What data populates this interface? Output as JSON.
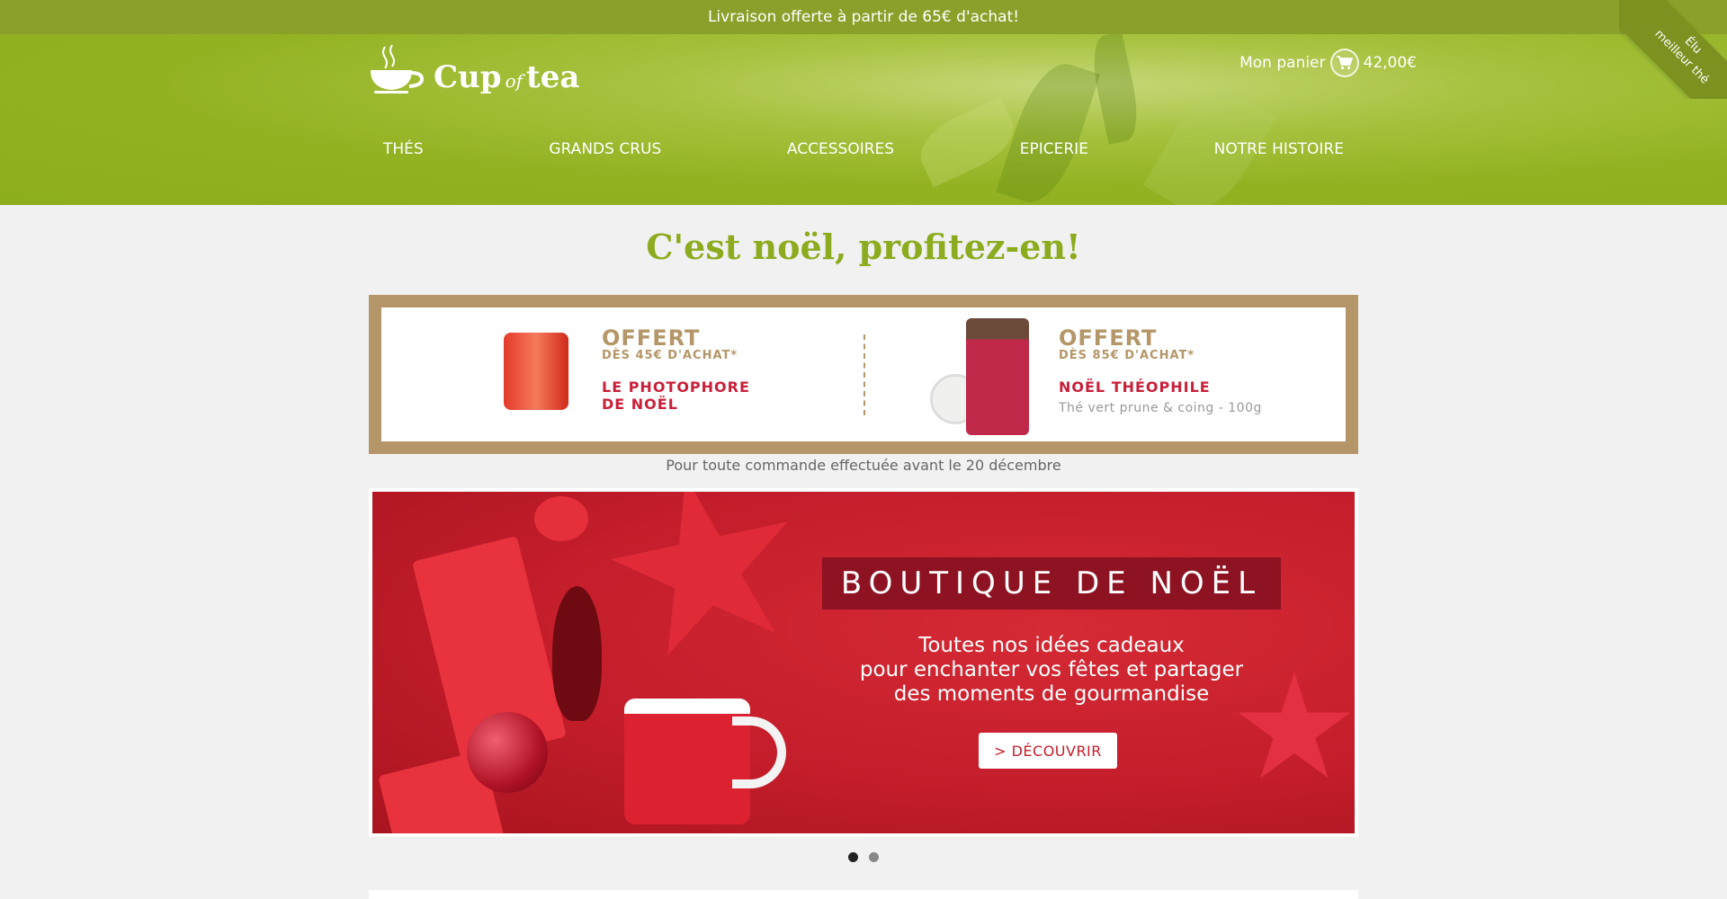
{
  "topbar": {
    "text": "Livraison offerte à partir de 65€ d'achat!"
  },
  "ribbon": {
    "line1": "Élu",
    "line2": "meilleur thé"
  },
  "logo": {
    "word1": "Cup",
    "word2": "of",
    "word3": "tea"
  },
  "cart": {
    "label": "Mon panier",
    "amount": "42,00€",
    "icon": "cart-icon"
  },
  "nav": {
    "items": [
      {
        "label": "THÉS"
      },
      {
        "label": "GRANDS CRUS"
      },
      {
        "label": "ACCESSOIRES"
      },
      {
        "label": "EPICERIE"
      },
      {
        "label": "NOTRE HISTOIRE"
      }
    ]
  },
  "headline": "C'est noël, profitez-en!",
  "offers": [
    {
      "title": "OFFERT",
      "threshold": "DÈS 45€ D'ACHAT*",
      "product_line1": "LE PHOTOPHORE",
      "product_line2": "DE NOËL",
      "detail": ""
    },
    {
      "title": "OFFERT",
      "threshold": "DÈS 85€ D'ACHAT*",
      "product_line1": "NOËL THÉOPHILE",
      "product_line2": "",
      "detail": "Thé vert prune & coing - 100g"
    }
  ],
  "offer_note": "Pour toute commande effectuée avant le 20 décembre",
  "hero": {
    "title": "BOUTIQUE DE NOËL",
    "line1": "Toutes nos idées cadeaux",
    "line2": "pour enchanter vos fêtes et partager",
    "line3": "des moments de gourmandise",
    "button": "> DÉCOUVRIR"
  },
  "carousel": {
    "active_index": 0,
    "count": 2
  },
  "colors": {
    "brand_green": "#8cab1e",
    "topbar_green": "#8ba02a",
    "offer_gold": "#b49668",
    "christmas_red": "#c41d2b"
  }
}
